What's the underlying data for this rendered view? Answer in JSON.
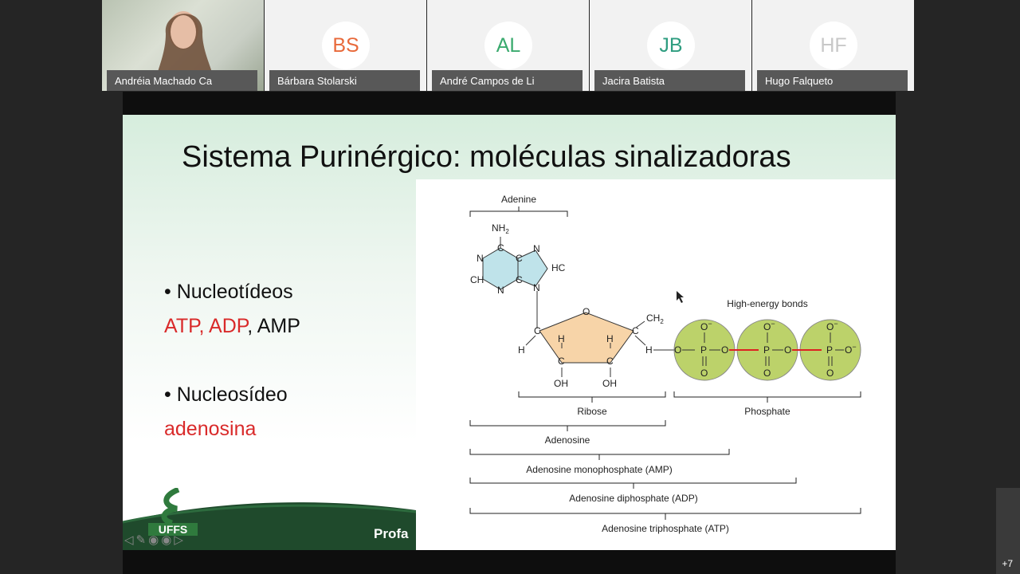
{
  "participants": [
    {
      "name": "Andréia Machado Ca",
      "video": true
    },
    {
      "name": "Bárbara Stolarski",
      "initials": "BS",
      "color": "#e8693a"
    },
    {
      "name": "André Campos de Li",
      "initials": "AL",
      "color": "#3aaa6e"
    },
    {
      "name": "Jacira Batista",
      "initials": "JB",
      "color": "#2e9d80"
    },
    {
      "name": "Hugo Falqueto",
      "initials": "HF",
      "color": "#c8c8c8"
    }
  ],
  "more_count": "+7",
  "slide": {
    "title": "Sistema Purinérgico: moléculas sinalizadoras",
    "bullet1": {
      "label": "• Nucleotídeos",
      "red": "ATP, ADP",
      "rest": ", AMP"
    },
    "bullet2": {
      "label": "• Nucleosídeo",
      "red": "adenosina"
    },
    "footer_text": "Profa",
    "logo_text": "UFFS"
  },
  "diagram": {
    "adenine": "Adenine",
    "nh2": "NH",
    "nh2_sub": "2",
    "hc": "HC",
    "ch": "CH",
    "n": "N",
    "c": "C",
    "o": "O",
    "h": "H",
    "oh": "OH",
    "ch2": "CH",
    "ch2_sub": "2",
    "p": "P",
    "ominus": "O",
    "minus": "−",
    "high_energy": "High-energy bonds",
    "ribose": "Ribose",
    "phosphate": "Phosphate",
    "adenosine": "Adenosine",
    "amp": "Adenosine monophosphate (AMP)",
    "adp": "Adenosine diphosphate (ADP)",
    "atp": "Adenosine triphosphate (ATP)"
  }
}
